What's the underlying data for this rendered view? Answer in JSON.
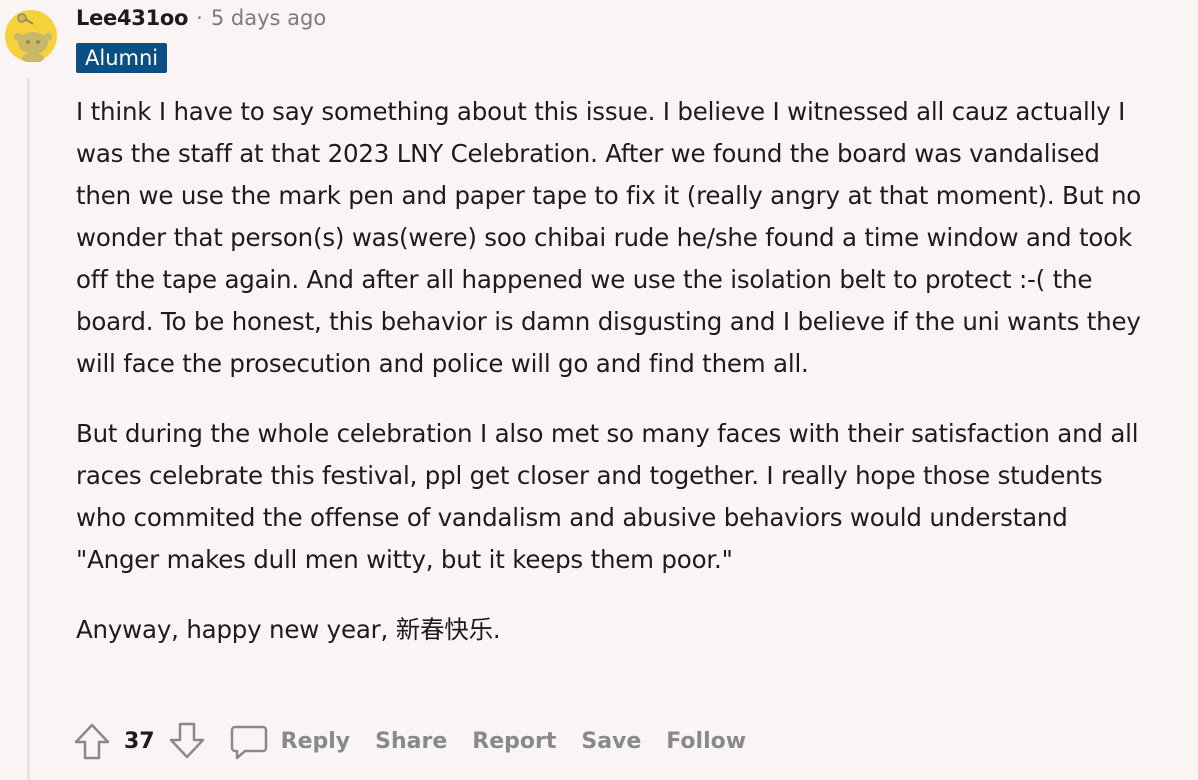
{
  "comment": {
    "username": "Lee431oo",
    "separator": "·",
    "timestamp": "5 days ago",
    "flair": "Alumni",
    "paragraphs": [
      "I think I have to say something about this issue. I believe I witnessed all cauz actually I was the staff at that 2023 LNY Celebration. After we found the board was vandalised then we use the mark pen and paper tape to fix it (really angry at that moment). But no wonder that person(s) was(were) soo chibai rude he/she found a time window and took off the tape again. And after all happened we use the isolation belt to protect :-( the board. To be honest, this behavior is damn disgusting and I believe if the uni wants they will face the prosecution and police will go and find them all.",
      "But during the whole celebration I also met so many faces with their satisfaction and all races celebrate this festival, ppl get closer and together. I really hope those students who commited the offense of vandalism and abusive behaviors would understand \"Anger makes dull men witty, but it keeps them poor.\"",
      "Anyway, happy new year, 新春快乐."
    ]
  },
  "actions": {
    "score": "37",
    "reply": "Reply",
    "share": "Share",
    "report": "Report",
    "save": "Save",
    "follow": "Follow"
  },
  "icons": {
    "avatar": "snoo-avatar-icon",
    "upvote": "upvote-arrow-icon",
    "downvote": "downvote-arrow-icon",
    "reply": "speech-bubble-icon"
  },
  "colors": {
    "background": "#fbf4f5",
    "flair_bg": "#0b4f84",
    "muted_text": "#878a8c",
    "avatar_yellow": "#f5d23a"
  }
}
